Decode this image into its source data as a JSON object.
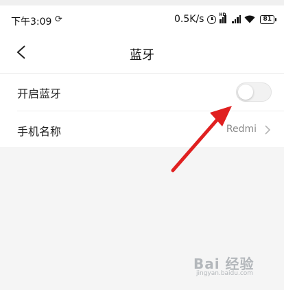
{
  "status_bar": {
    "time": "下午3:09",
    "location_icon": "loc-icon",
    "net_speed": "0.5K/s",
    "hd_label": "HD",
    "battery": "81"
  },
  "header": {
    "title": "蓝牙",
    "back_icon": "chevron-left-icon"
  },
  "settings": {
    "bluetooth": {
      "label": "开启蓝牙",
      "enabled": false
    },
    "device_name": {
      "label": "手机名称",
      "value": "Redmi"
    }
  },
  "colors": {
    "arrow": "#e02020",
    "toggle_off": "#f2f2f2",
    "background": "#f5f5f5"
  },
  "watermark": {
    "text": "Bai 经验",
    "url": "jingyan.baidu.com"
  }
}
